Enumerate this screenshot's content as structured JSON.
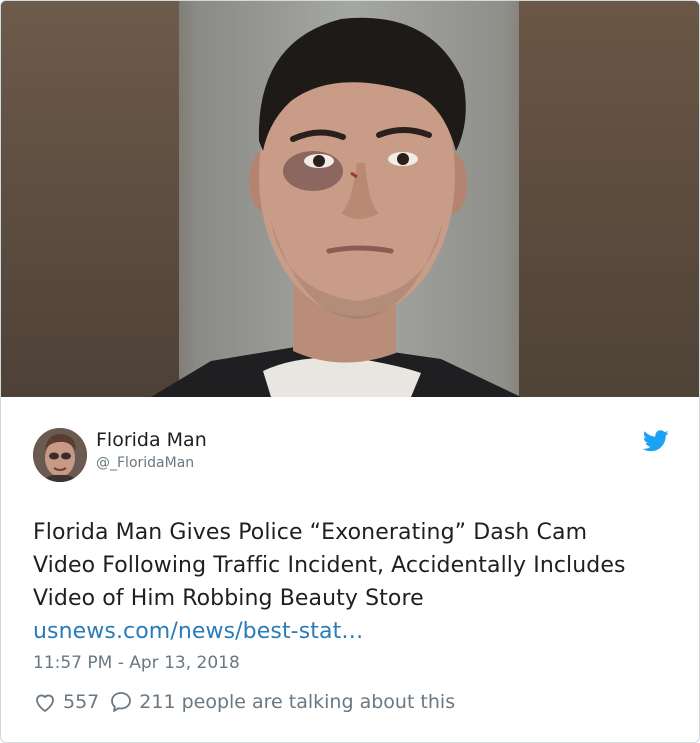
{
  "tweet": {
    "author_name": "Florida Man",
    "author_handle": "@_FloridaMan",
    "text": "Florida Man Gives Police “Exonerating” Dash Cam Video Following Traffic Incident, Accidentally Includes Video of Him Robbing Beauty Store",
    "link_text": "usnews.com/news/best-stat…",
    "timestamp": "11:57 PM - Apr 13, 2018",
    "likes": "557",
    "replies_text": "211 people are talking about this"
  },
  "icons": {
    "brand": "twitter-bird-icon",
    "like": "heart-icon",
    "reply": "speech-bubble-icon"
  },
  "colors": {
    "link": "#2b7bb9",
    "brand": "#1da1f2",
    "muted": "#697882"
  }
}
